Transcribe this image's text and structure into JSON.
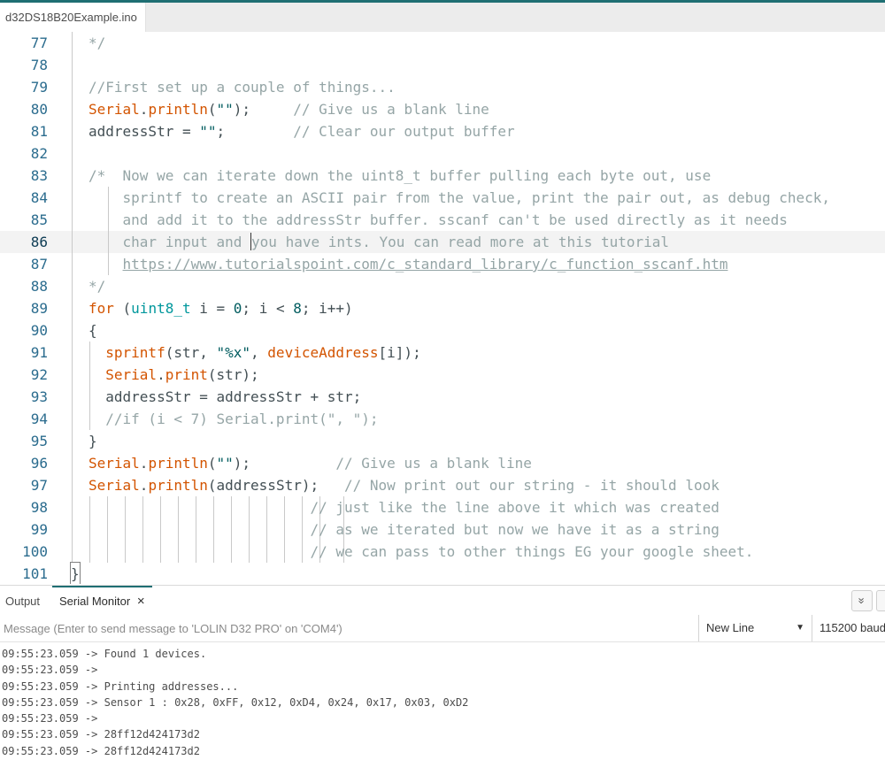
{
  "tabs": {
    "file": "d32DS18B20Example.ino"
  },
  "editor": {
    "active_line": "86",
    "lines": [
      {
        "n": "77",
        "t": "*/"
      },
      {
        "n": "78",
        "t": ""
      },
      {
        "n": "79",
        "t": "//First set up a couple of things..."
      },
      {
        "n": "80",
        "a": "Serial",
        "b": ".",
        "c": "println",
        "d": "(",
        "e": "\"\"",
        "f": ");",
        "g": "     // Give us a blank line"
      },
      {
        "n": "81",
        "a": "addressStr = ",
        "e": "\"\"",
        "f": ";",
        "g": "        // Clear our output buffer"
      },
      {
        "n": "82",
        "t": ""
      },
      {
        "n": "83",
        "t": "/*  Now we can iterate down the uint8_t buffer pulling each byte out, use"
      },
      {
        "n": "84",
        "t": "    sprintf to create an ASCII pair from the value, print the pair out, as debug check,"
      },
      {
        "n": "85",
        "t": "    and add it to the addressStr buffer. sscanf can't be used directly as it needs"
      },
      {
        "n": "86",
        "t1": "    char input and ",
        "t2": "you have ints. You can read more at this tutorial"
      },
      {
        "n": "87",
        "t1": "    ",
        "link": "https://www.tutorialspoint.com/c_standard_library/c_function_sscanf.htm"
      },
      {
        "n": "88",
        "t": "*/"
      },
      {
        "n": "89",
        "kw": "for",
        "p1": " (",
        "ty": "uint8_t",
        "p2": " i = ",
        "num0": "0",
        "p3": "; i < ",
        "num8": "8",
        "p4": "; i++)"
      },
      {
        "n": "90",
        "t": "{"
      },
      {
        "n": "91",
        "a": "  ",
        "kw": "sprintf",
        "p1": "(str, ",
        "s": "\"%x\"",
        "p2": ", ",
        "kw2": "deviceAddress",
        "p3": "[i]);"
      },
      {
        "n": "92",
        "a": "  ",
        "kw": "Serial",
        "p1": ".",
        "kw2": "print",
        "p2": "(str);"
      },
      {
        "n": "93",
        "t": "  addressStr = addressStr + str;"
      },
      {
        "n": "94",
        "t": "  //if (i < 7) Serial.print(\", \");"
      },
      {
        "n": "95",
        "t": "}"
      },
      {
        "n": "96",
        "a": "Serial",
        "b": ".",
        "c": "println",
        "d": "(",
        "e": "\"\"",
        "f": ");",
        "g": "          // Give us a blank line"
      },
      {
        "n": "97",
        "a": "Serial",
        "b": ".",
        "c": "println",
        "d": "(addressStr);",
        "g": "   // Now print out our string - it should look"
      },
      {
        "n": "98",
        "g": "                          // just like the line above it which was created"
      },
      {
        "n": "99",
        "g": "                          // as we iterated but now we have it as a string"
      },
      {
        "n": "100",
        "g": "                          // we can pass to other things EG your google sheet."
      },
      {
        "n": "101",
        "t": "}"
      }
    ]
  },
  "panel": {
    "tab_output": "Output",
    "tab_serial": "Serial Monitor",
    "close_glyph": "×",
    "collapse_glyph": "»",
    "message_placeholder": "Message (Enter to send message to 'LOLIN D32 PRO' on 'COM4')",
    "line_ending": "New Line",
    "baud": "115200 baud"
  },
  "serial_output": [
    "09:55:23.059 -> Found 1 devices.",
    "09:55:23.059 -> ",
    "09:55:23.059 -> Printing addresses...",
    "09:55:23.059 -> Sensor 1 : 0x28, 0xFF, 0x12, 0xD4, 0x24, 0x17, 0x03, 0xD2",
    "09:55:23.059 -> ",
    "09:55:23.059 -> 28ff12d424173d2",
    "09:55:23.059 -> 28ff12d424173d2"
  ]
}
